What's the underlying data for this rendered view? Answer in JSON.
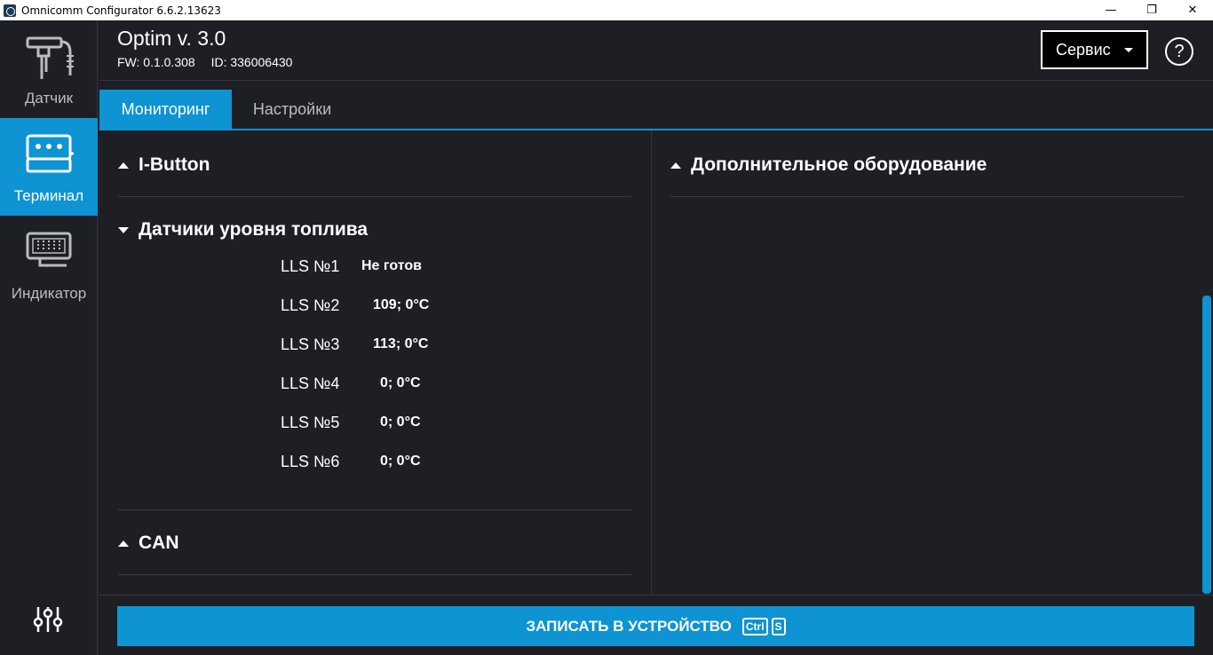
{
  "window": {
    "title": "Omnicomm Configurator 6.6.2.13623",
    "minimize": "—",
    "restore": "❐",
    "close": "✕"
  },
  "sidebar": {
    "items": [
      {
        "label": "Датчик",
        "icon": "sensor-icon"
      },
      {
        "label": "Терминал",
        "icon": "terminal-icon",
        "active": true
      },
      {
        "label": "Индикатор",
        "icon": "indicator-icon"
      }
    ],
    "settings_icon": "sliders-icon"
  },
  "header": {
    "device": "Optim v. 3.0",
    "fw": "FW: 0.1.0.308",
    "id": "ID: 336006430",
    "service_label": "Сервис",
    "help": "?"
  },
  "tabs": [
    {
      "label": "Мониторинг",
      "active": true
    },
    {
      "label": "Настройки",
      "active": false
    }
  ],
  "left_panel": {
    "sections": {
      "ibutton": "I-Button",
      "fuel": "Датчики уровня топлива",
      "can": "CAN"
    },
    "lls": [
      {
        "name": "LLS №1",
        "value": "Не готов"
      },
      {
        "name": "LLS №2",
        "value": "109;  0°C"
      },
      {
        "name": "LLS №3",
        "value": "113;  0°C"
      },
      {
        "name": "LLS №4",
        "value": "0;  0°C"
      },
      {
        "name": "LLS №5",
        "value": "0;  0°C"
      },
      {
        "name": "LLS №6",
        "value": "0;  0°C"
      }
    ]
  },
  "right_panel": {
    "section": "Дополнительное оборудование"
  },
  "footer": {
    "write_label": "ЗАПИСАТЬ В УСТРОЙСТВО",
    "key1": "Ctrl",
    "key2": "S"
  },
  "colors": {
    "accent": "#0e93d3",
    "background": "#1e1f24"
  }
}
